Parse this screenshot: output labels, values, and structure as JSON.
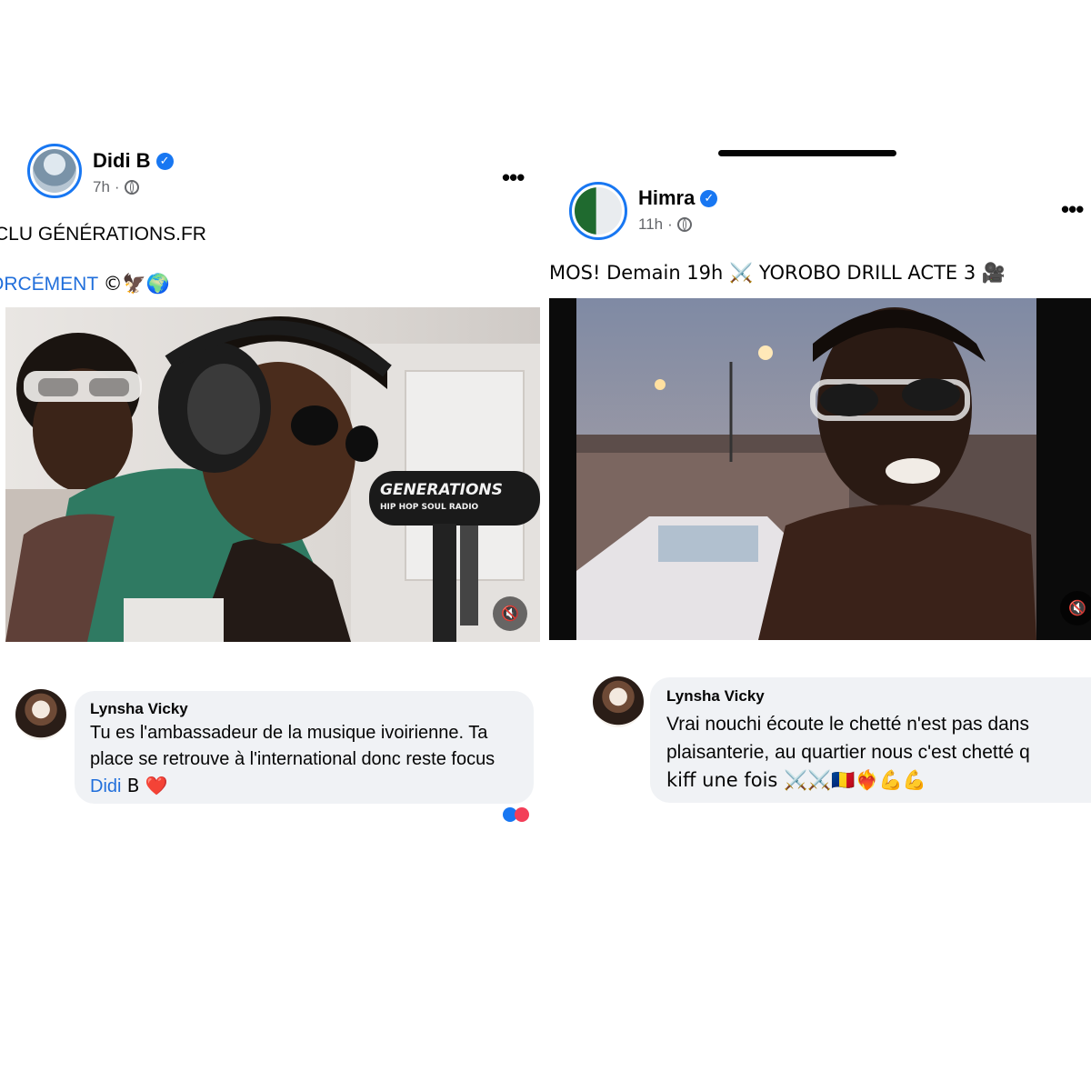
{
  "left_post": {
    "author": "Didi B",
    "verified": true,
    "time": "7h",
    "meta_separator": "·",
    "visibility_icon": "globe-icon",
    "more_icon": "more-options-icon",
    "caption_line1": "CLU GÉNÉRATIONS.FR",
    "caption_line2_prefix": "ORCÉMENT",
    "caption_line2_emoji": "©🦅🌍",
    "video_overlay_text": "GENERATIONS",
    "video_overlay_subtext": "HIP HOP SOUL RADIO",
    "mute_icon": "mute-icon",
    "comment": {
      "author": "Lynsha Vicky",
      "text_before": "Tu es l'ambassadeur de la musique ivoirienne. Ta place se retrouve à l'international donc reste focus ",
      "mention": "Didi",
      "text_after": " B ❤️"
    }
  },
  "right_post": {
    "author": "Himra",
    "verified": true,
    "time": "11h",
    "meta_separator": "·",
    "visibility_icon": "globe-icon",
    "more_icon": "more-options-icon",
    "caption": "MOS! Demain 19h ⚔️ YOROBO DRILL ACTE 3 🎥",
    "mute_icon": "mute-icon",
    "comment": {
      "author": "Lynsha Vicky",
      "line1": "Vrai nouchi écoute le chetté n'est pas dans",
      "line2": "plaisanterie, au quartier nous c'est chetté q",
      "line3": "kiff une fois ⚔️⚔️🇷🇴❤️‍🔥💪💪"
    }
  },
  "colors": {
    "verified_blue": "#1877f2",
    "link_blue": "#216fdb",
    "bubble_gray": "#f0f2f5",
    "meta_gray": "#65676b"
  }
}
